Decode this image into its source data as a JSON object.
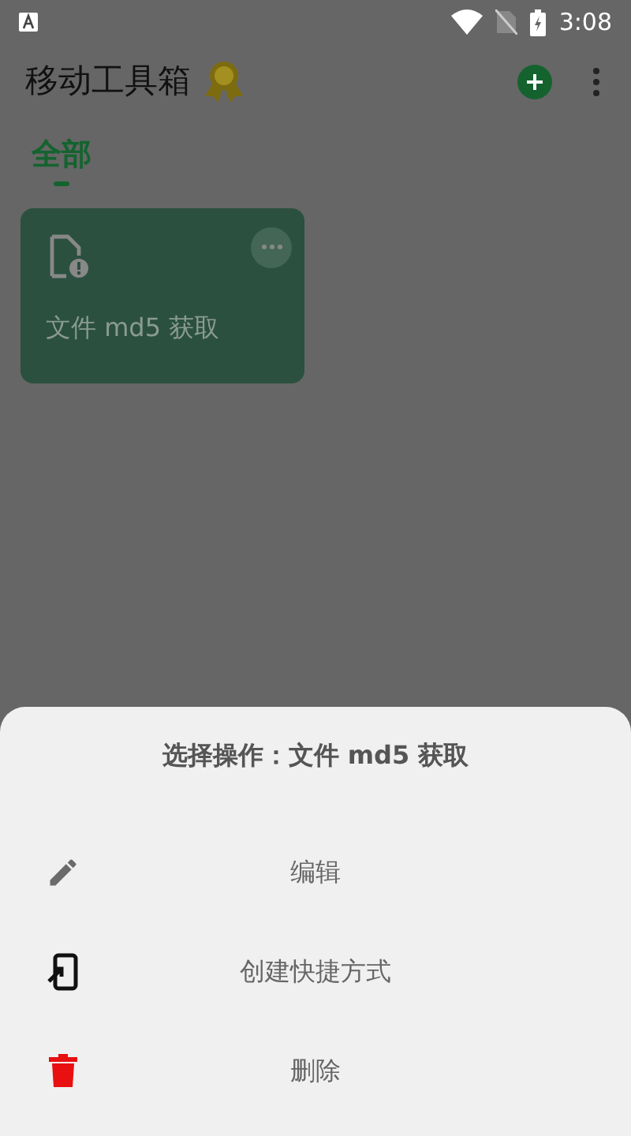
{
  "status_bar": {
    "time": "3:08"
  },
  "app_bar": {
    "title": "移动工具箱"
  },
  "tabs": [
    {
      "label": "全部",
      "selected": true
    }
  ],
  "tools": [
    {
      "name": "文件 md5 获取"
    }
  ],
  "sheet": {
    "title": "选择操作：文件 md5 获取",
    "actions": [
      {
        "kind": "edit",
        "label": "编辑"
      },
      {
        "kind": "shortcut",
        "label": "创建快捷方式"
      },
      {
        "kind": "delete",
        "label": "删除"
      }
    ]
  }
}
